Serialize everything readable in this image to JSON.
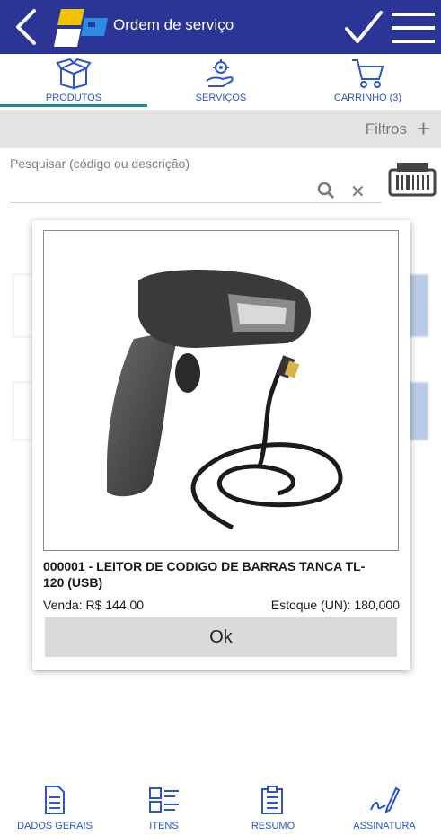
{
  "header": {
    "title": "Ordem de serviço"
  },
  "tabs": [
    {
      "label": "PRODUTOS",
      "icon": "box-icon",
      "active": true
    },
    {
      "label": "SERVIÇOS",
      "icon": "service-hand-gear-icon",
      "active": false
    },
    {
      "label": "CARRINHO (3)",
      "icon": "cart-icon",
      "active": false
    }
  ],
  "filters": {
    "label": "Filtros"
  },
  "search": {
    "placeholder": "Pesquisar (código ou descrição)"
  },
  "modal": {
    "product_title": "000001 - LEITOR DE CODIGO DE BARRAS TANCA TL-120 (USB)",
    "price": "Venda: R$ 144,00",
    "stock": "Estoque (UN): 180,000",
    "ok_label": "Ok"
  },
  "bottom_nav": [
    {
      "label": "DADOS GERAIS",
      "icon": "document-icon",
      "active": false
    },
    {
      "label": "ITENS",
      "icon": "items-list-icon",
      "active": true
    },
    {
      "label": "RESUMO",
      "icon": "clipboard-icon",
      "active": false
    },
    {
      "label": "ASSINATURA",
      "icon": "signature-pen-icon",
      "active": false
    }
  ],
  "colors": {
    "header_bg": "#2b3595",
    "accent": "#2b55c8",
    "underline": "#1e8a8a"
  }
}
